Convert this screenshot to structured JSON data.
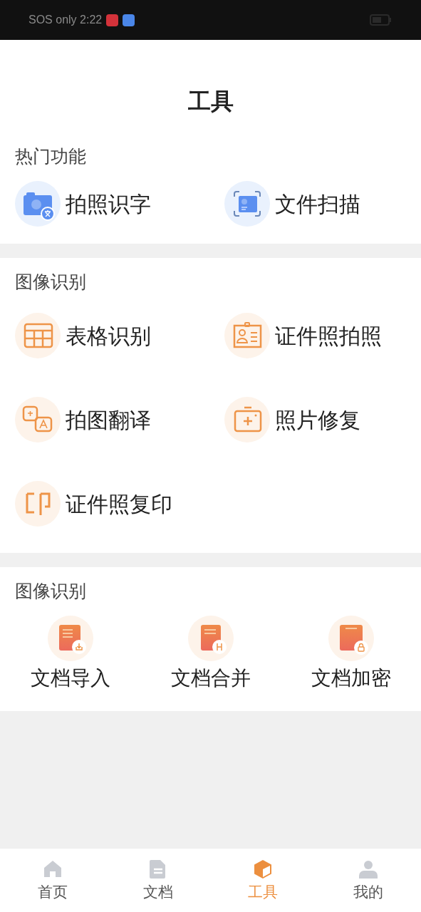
{
  "status_bar": {
    "text": "SOS only 2:22"
  },
  "title": "工具",
  "sections": [
    {
      "heading": "热门功能",
      "kind": "list",
      "items": [
        {
          "label": "拍照识字"
        },
        {
          "label": "文件扫描"
        }
      ]
    },
    {
      "heading": "图像识别",
      "kind": "list",
      "items": [
        {
          "label": "表格识别"
        },
        {
          "label": "证件照拍照"
        },
        {
          "label": "拍图翻译"
        },
        {
          "label": "照片修复"
        },
        {
          "label": "证件照复印"
        }
      ]
    },
    {
      "heading": "图像识别",
      "kind": "grid",
      "items": [
        {
          "label": "文档导入"
        },
        {
          "label": "文档合并"
        },
        {
          "label": "文档加密"
        }
      ]
    }
  ],
  "tabs": [
    {
      "label": "首页",
      "selected": false
    },
    {
      "label": "文档",
      "selected": false
    },
    {
      "label": "工具",
      "selected": true
    },
    {
      "label": "我的",
      "selected": false
    }
  ]
}
